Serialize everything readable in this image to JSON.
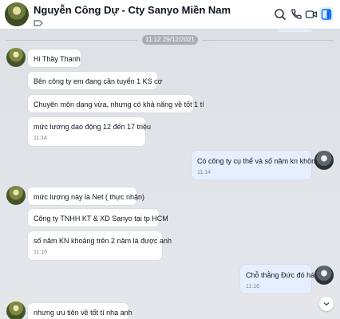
{
  "header": {
    "title": "Nguyễn Công Dự - Cty Sanyo Miền Nam",
    "icons": [
      "search-icon",
      "phone-icon",
      "video-call-icon",
      "sidebar-toggle-icon"
    ],
    "accent": "#0068ff"
  },
  "chat": {
    "date_separator": "11:12 29/12/2021",
    "messages": [
      {
        "text": "Hi Thầy Thanh"
      },
      {
        "text": "Bên công ty em đang cần tuyển 1 KS cơ"
      },
      {
        "text": "Chuyên môn dạng vừa, nhưng có khả năng về tốt 1 tí"
      },
      {
        "text": "mức lương dao động 12 đến 17 triệu",
        "time": "11:14"
      },
      {
        "text": "Có công ty cụ thể và số năm kn không",
        "time": "11:14"
      },
      {
        "text": "mức lượng này là Net ( thực nhận)"
      },
      {
        "text": "Công ty TNHH KT & XD Sanyo tại tp HCM"
      },
      {
        "text": "số năm KN khoảng trên 2 năm là được anh",
        "time": "11:16"
      },
      {
        "text": "Chỗ thằng Đức đó há",
        "time": "11:16"
      },
      {
        "text": "nhưng ưu tiên về tốt tí nha anh"
      }
    ]
  }
}
